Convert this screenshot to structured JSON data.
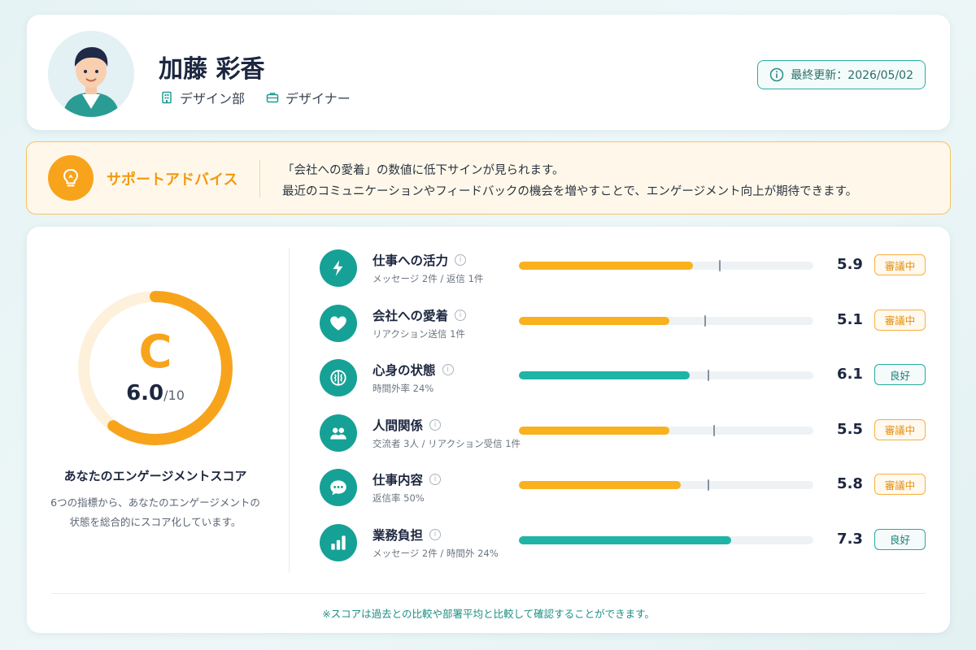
{
  "profile": {
    "name": "加藤 彩香",
    "department": "デザイン部",
    "role": "デザイナー",
    "last_updated": "最終更新：2026/05/02"
  },
  "advice": {
    "title": "サポートアドバイス",
    "line1": "「会社への愛着」の数値に低下サインが見られます。",
    "line2": "最近のコミュニケーションやフィードバックの機会を増やすことで、エンゲージメント向上が期待できます。"
  },
  "score": {
    "grade": "C",
    "value": "6.0",
    "max": "/10",
    "fraction": 0.6,
    "title": "あなたのエンゲージメントスコア",
    "desc_line1": "6つの指標から、あなたのエンゲージメントの",
    "desc_line2": "状態を総合的にスコア化しています。"
  },
  "metrics": [
    {
      "name": "仕事への活力",
      "sub": "メッセージ 2件 / 返信 1件",
      "value": "5.9",
      "bar": 5.9,
      "avg": 6.8,
      "status": "審議中",
      "level": "warn",
      "icon": "bolt-icon"
    },
    {
      "name": "会社への愛着",
      "sub": "リアクション送信 1件",
      "value": "5.1",
      "bar": 5.1,
      "avg": 6.3,
      "status": "審議中",
      "level": "warn",
      "icon": "heart-icon"
    },
    {
      "name": "心身の状態",
      "sub": "時間外率 24%",
      "value": "6.1",
      "bar": 5.8,
      "avg": 6.4,
      "status": "良好",
      "level": "good",
      "icon": "brain-icon"
    },
    {
      "name": "人間関係",
      "sub": "交流者 3人 / リアクション受信 1件",
      "value": "5.5",
      "bar": 5.1,
      "avg": 6.6,
      "status": "審議中",
      "level": "warn",
      "icon": "people-icon"
    },
    {
      "name": "仕事内容",
      "sub": "返信率 50%",
      "value": "5.8",
      "bar": 5.5,
      "avg": 6.4,
      "status": "審議中",
      "level": "warn",
      "icon": "chat-bubble-icon"
    },
    {
      "name": "業務負担",
      "sub": "メッセージ 2件 / 時間外 24%",
      "value": "7.3",
      "bar": 7.2,
      "avg": null,
      "status": "良好",
      "level": "good",
      "icon": "bar-chart-icon"
    }
  ],
  "footer_note": "※スコアは過去との比較や部署平均と比較して確認することができます。",
  "colors": {
    "accent": "#16a196",
    "warn": "#f9b11e",
    "grade": "#f7a41c",
    "advice_bg": "#fff8ea"
  }
}
